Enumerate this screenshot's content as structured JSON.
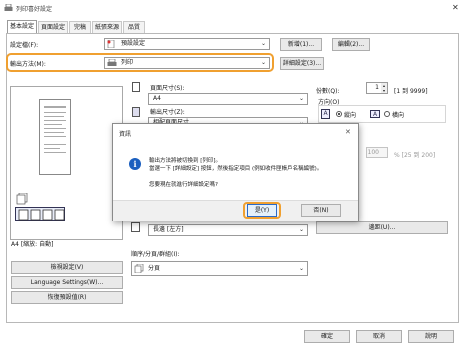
{
  "window": {
    "title": "列印喜好設定",
    "close_glyph": "✕"
  },
  "tabs": [
    {
      "label": "基本設定",
      "active": true
    },
    {
      "label": "頁面設定"
    },
    {
      "label": "完稿"
    },
    {
      "label": "紙張來源"
    },
    {
      "label": "品質"
    }
  ],
  "profile": {
    "label": "設定檔(F):",
    "value": "預設設定",
    "add_button": "新增(1)...",
    "edit_button": "編輯(2)..."
  },
  "output_method": {
    "label": "輸出方法(M):",
    "value": "列印",
    "details_button": "詳細設定(3)..."
  },
  "page_size": {
    "label": "頁面尺寸(S):",
    "value": "A4"
  },
  "output_size": {
    "label": "輸出尺寸(Z):",
    "value": "相配頁面尺寸"
  },
  "copies": {
    "label": "份數(Q):",
    "value": "1",
    "range": "[1 到 9999]"
  },
  "orientation": {
    "label": "方向(O)",
    "portrait": "縱向",
    "landscape": "橫向"
  },
  "scaling": {
    "value": "100",
    "range": "% [25 到 200]"
  },
  "preview": {
    "caption": "A4 [縮放: 自動]"
  },
  "binding": {
    "value": "長邊 [左方]"
  },
  "margin_button": "邊距(U)...",
  "finishing": {
    "label": "順序/分頁/群組(I):",
    "value": "分頁"
  },
  "left_buttons": {
    "view_settings": "檢視設定(V)",
    "language": "Language Settings(W)...",
    "restore": "恢復預設值(R)"
  },
  "footer": {
    "ok": "確定",
    "cancel": "取消",
    "help": "說明"
  },
  "dialog": {
    "title": "資訊",
    "message_line1": "輸出方法將被切換到 [列印]。",
    "message_line2": "當選一下 [詳細設定] 按鈕，然後指定項目 (例如收件匣帳戶名稱編號)。",
    "question": "您要現在就進行詳細設定嗎?",
    "yes": "是(Y)",
    "no": "否(N)",
    "info_glyph": "i"
  },
  "colors": {
    "accent_orange": "#f0a030",
    "focus_blue": "#2a6ac8"
  }
}
